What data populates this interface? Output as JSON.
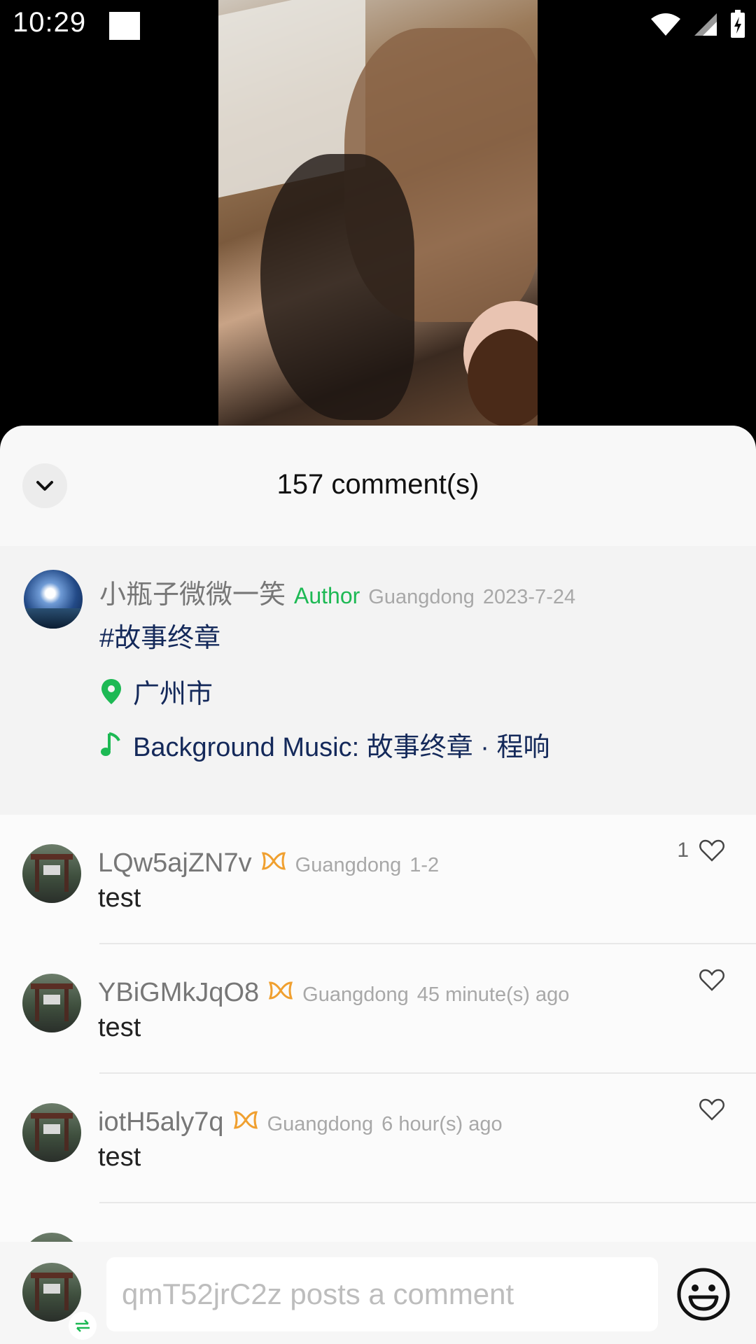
{
  "status_bar": {
    "time": "10:29",
    "icons": [
      "notification-square-icon",
      "wifi-icon",
      "signal-icon",
      "battery-charging-icon"
    ]
  },
  "sheet": {
    "title": "157 comment(s)",
    "collapse_icon": "chevron-down-icon"
  },
  "author_post": {
    "username": "小瓶子微微一笑",
    "author_label": "Author",
    "region": "Guangdong",
    "date": "2023-7-24",
    "hashtag": "#故事终章",
    "location_icon": "location-pin-icon",
    "location": "广州市",
    "music_icon": "music-note-icon",
    "music": "Background Music: 故事终章 · 程响"
  },
  "comments": [
    {
      "username": "LQw5ajZN7v",
      "badge_icon": "ribbon-badge-icon",
      "region": "Guangdong",
      "time": "1-2",
      "text": "test",
      "likes": "1"
    },
    {
      "username": "YBiGMkJqO8",
      "badge_icon": "ribbon-badge-icon",
      "region": "Guangdong",
      "time": "45 minute(s) ago",
      "text": "test",
      "likes": ""
    },
    {
      "username": "iotH5aly7q",
      "badge_icon": "ribbon-badge-icon",
      "region": "Guangdong",
      "time": "6 hour(s) ago",
      "text": "test",
      "likes": ""
    }
  ],
  "composer": {
    "placeholder": "qmT52jrC2z posts a comment",
    "emoji_icon": "emoji-smile-icon",
    "switch_icon": "switch-account-icon"
  },
  "colors": {
    "accent_green": "#1db954",
    "link_blue": "#14295a",
    "badge_orange": "#f0a030"
  }
}
